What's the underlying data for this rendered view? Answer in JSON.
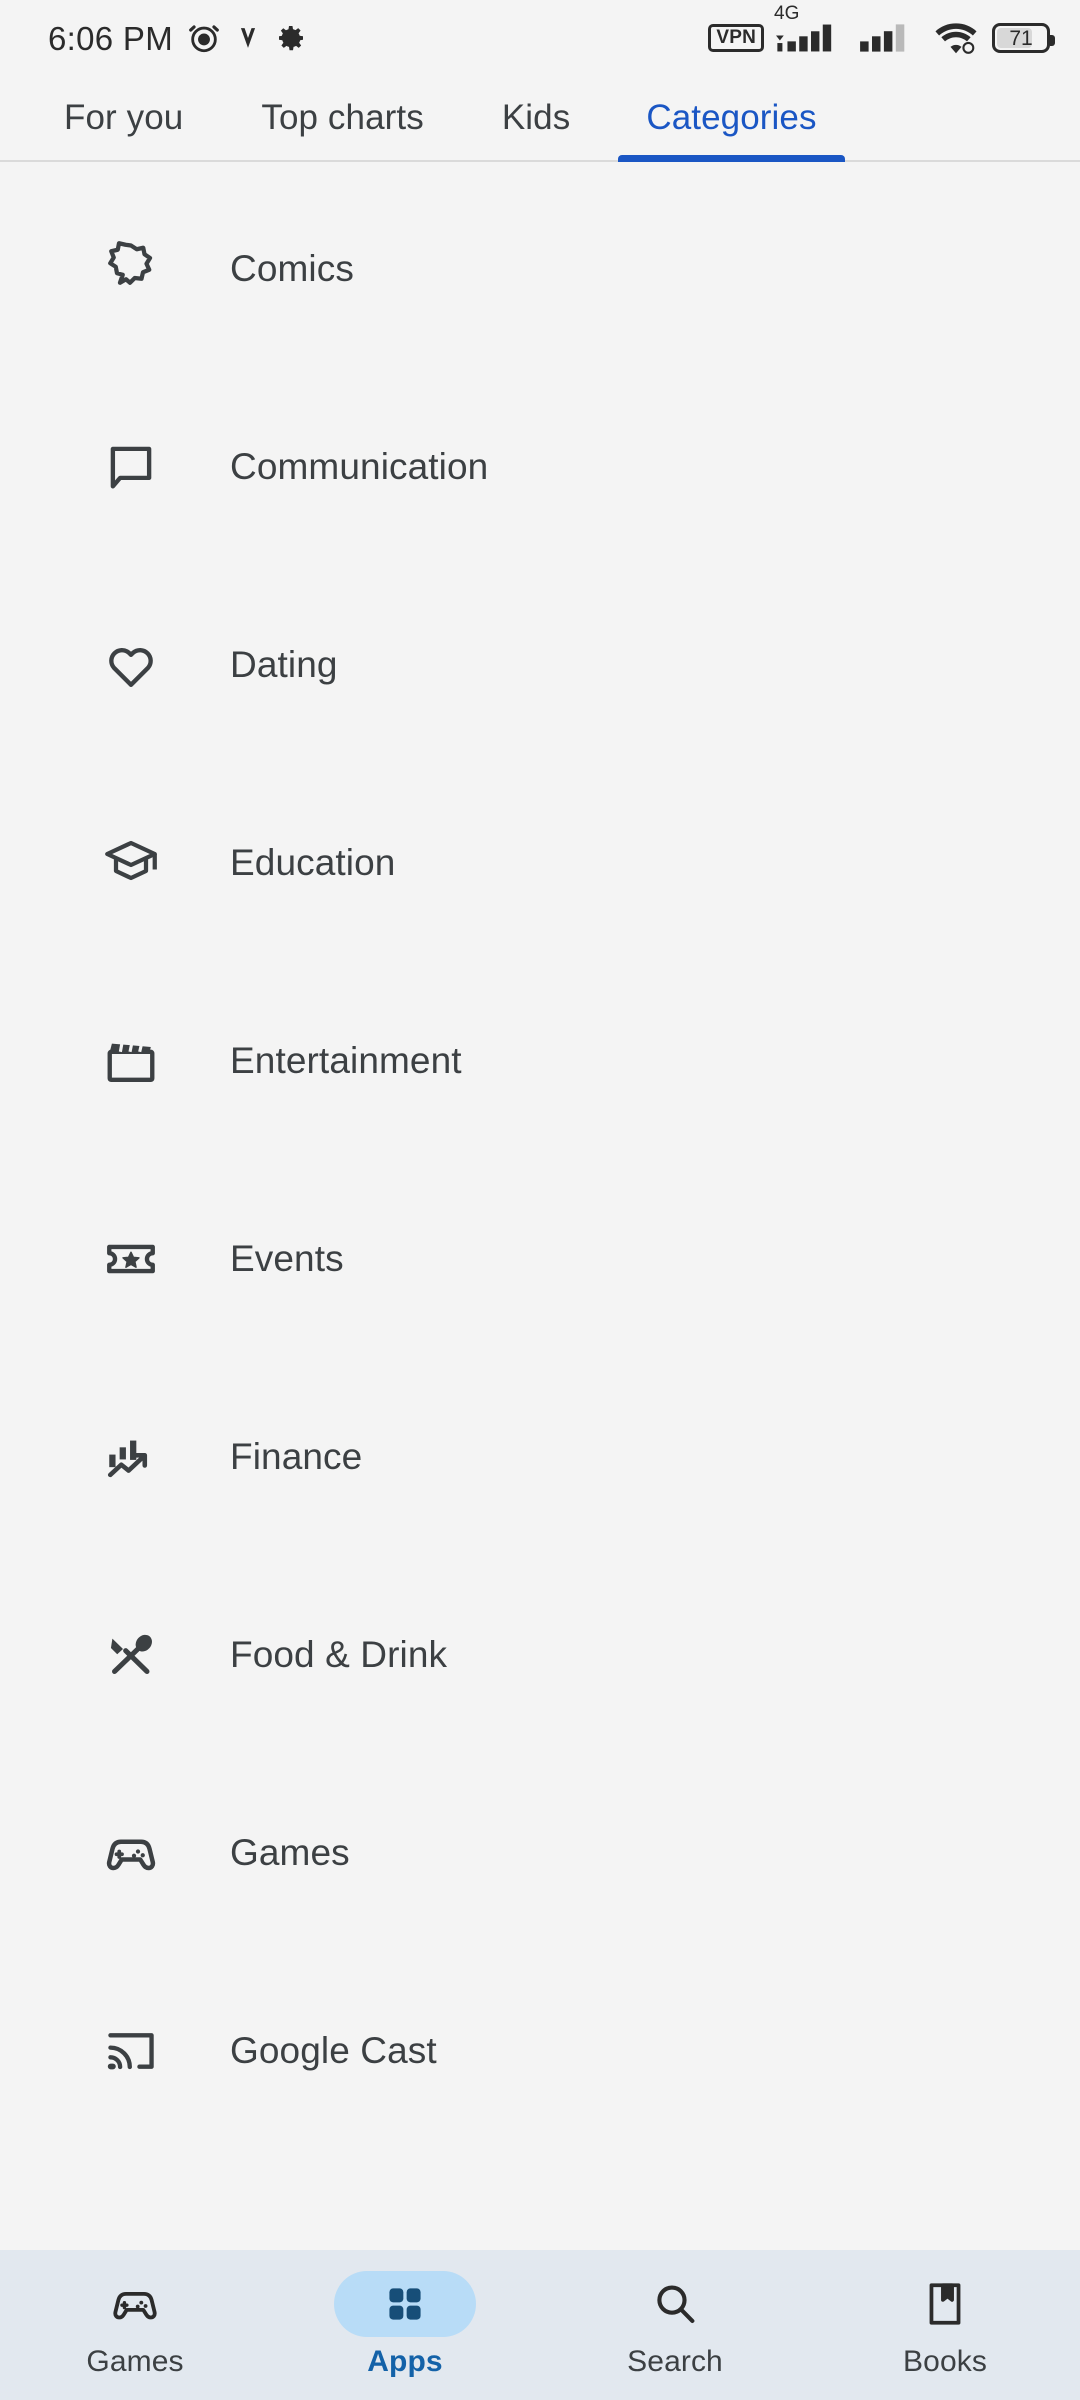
{
  "status_bar": {
    "time": "6:06 PM",
    "left_icons": [
      "alarm-icon",
      "vibrate-icon",
      "gear-icon"
    ],
    "vpn_label": "VPN",
    "network_label": "4G",
    "battery_level": "71",
    "right_icons": [
      "vpn-icon",
      "cellular-signal-icon",
      "cellular-signal-2-icon",
      "wifi-icon",
      "battery-icon"
    ]
  },
  "tabs": [
    {
      "label": "For you",
      "active": false
    },
    {
      "label": "Top charts",
      "active": false
    },
    {
      "label": "Kids",
      "active": false
    },
    {
      "label": "Categories",
      "active": true
    }
  ],
  "categories": [
    {
      "label": "Comics",
      "icon": "comic-bubble-icon"
    },
    {
      "label": "Communication",
      "icon": "chat-bubble-icon"
    },
    {
      "label": "Dating",
      "icon": "heart-icon"
    },
    {
      "label": "Education",
      "icon": "graduation-cap-icon"
    },
    {
      "label": "Entertainment",
      "icon": "clapperboard-icon"
    },
    {
      "label": "Events",
      "icon": "ticket-star-icon"
    },
    {
      "label": "Finance",
      "icon": "bar-chart-arrow-icon"
    },
    {
      "label": "Food & Drink",
      "icon": "spoon-knife-icon"
    },
    {
      "label": "Games",
      "icon": "gamepad-icon"
    },
    {
      "label": "Google Cast",
      "icon": "cast-icon"
    }
  ],
  "bottom_nav": [
    {
      "label": "Games",
      "icon": "gamepad-icon",
      "active": false
    },
    {
      "label": "Apps",
      "icon": "apps-grid-icon",
      "active": true
    },
    {
      "label": "Search",
      "icon": "search-icon",
      "active": false
    },
    {
      "label": "Books",
      "icon": "book-bookmark-icon",
      "active": false
    }
  ],
  "colors": {
    "accent_blue": "#1a56c4",
    "nav_active_blue": "#1462a8",
    "nav_pill_bg": "#b8dcf7",
    "nav_bar_bg": "#e2e8ef",
    "page_bg": "#f4f4f4",
    "text": "#3c4043"
  }
}
